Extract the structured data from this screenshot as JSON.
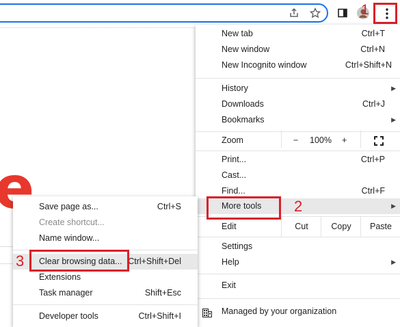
{
  "menu": {
    "items": [
      {
        "label": "New tab",
        "shortcut": "Ctrl+T"
      },
      {
        "label": "New window",
        "shortcut": "Ctrl+N"
      },
      {
        "label": "New Incognito window",
        "shortcut": "Ctrl+Shift+N"
      },
      {
        "label": "History"
      },
      {
        "label": "Downloads",
        "shortcut": "Ctrl+J"
      },
      {
        "label": "Bookmarks"
      },
      {
        "label": "Zoom"
      },
      {
        "label": "Print...",
        "shortcut": "Ctrl+P"
      },
      {
        "label": "Cast..."
      },
      {
        "label": "Find...",
        "shortcut": "Ctrl+F"
      },
      {
        "label": "More tools"
      },
      {
        "label": "Edit"
      },
      {
        "label": "Settings"
      },
      {
        "label": "Help"
      },
      {
        "label": "Exit"
      },
      {
        "label": "Managed by your organization"
      }
    ],
    "zoom": {
      "minus": "−",
      "value": "100%",
      "plus": "+"
    },
    "edit": {
      "cut": "Cut",
      "copy": "Copy",
      "paste": "Paste"
    }
  },
  "submenu": {
    "items": [
      {
        "label": "Save page as...",
        "shortcut": "Ctrl+S"
      },
      {
        "label": "Create shortcut..."
      },
      {
        "label": "Name window..."
      },
      {
        "label": "Clear browsing data...",
        "shortcut": "Ctrl+Shift+Del"
      },
      {
        "label": "Extensions"
      },
      {
        "label": "Task manager",
        "shortcut": "Shift+Esc"
      },
      {
        "label": "Developer tools",
        "shortcut": "Ctrl+Shift+I"
      }
    ]
  },
  "annotations": {
    "step1": "1",
    "step2": "2",
    "step3": "3"
  },
  "page": {
    "logo_fragment": "e"
  },
  "colors": {
    "highlight": "#d9202a",
    "accent": "#1a73e8"
  }
}
